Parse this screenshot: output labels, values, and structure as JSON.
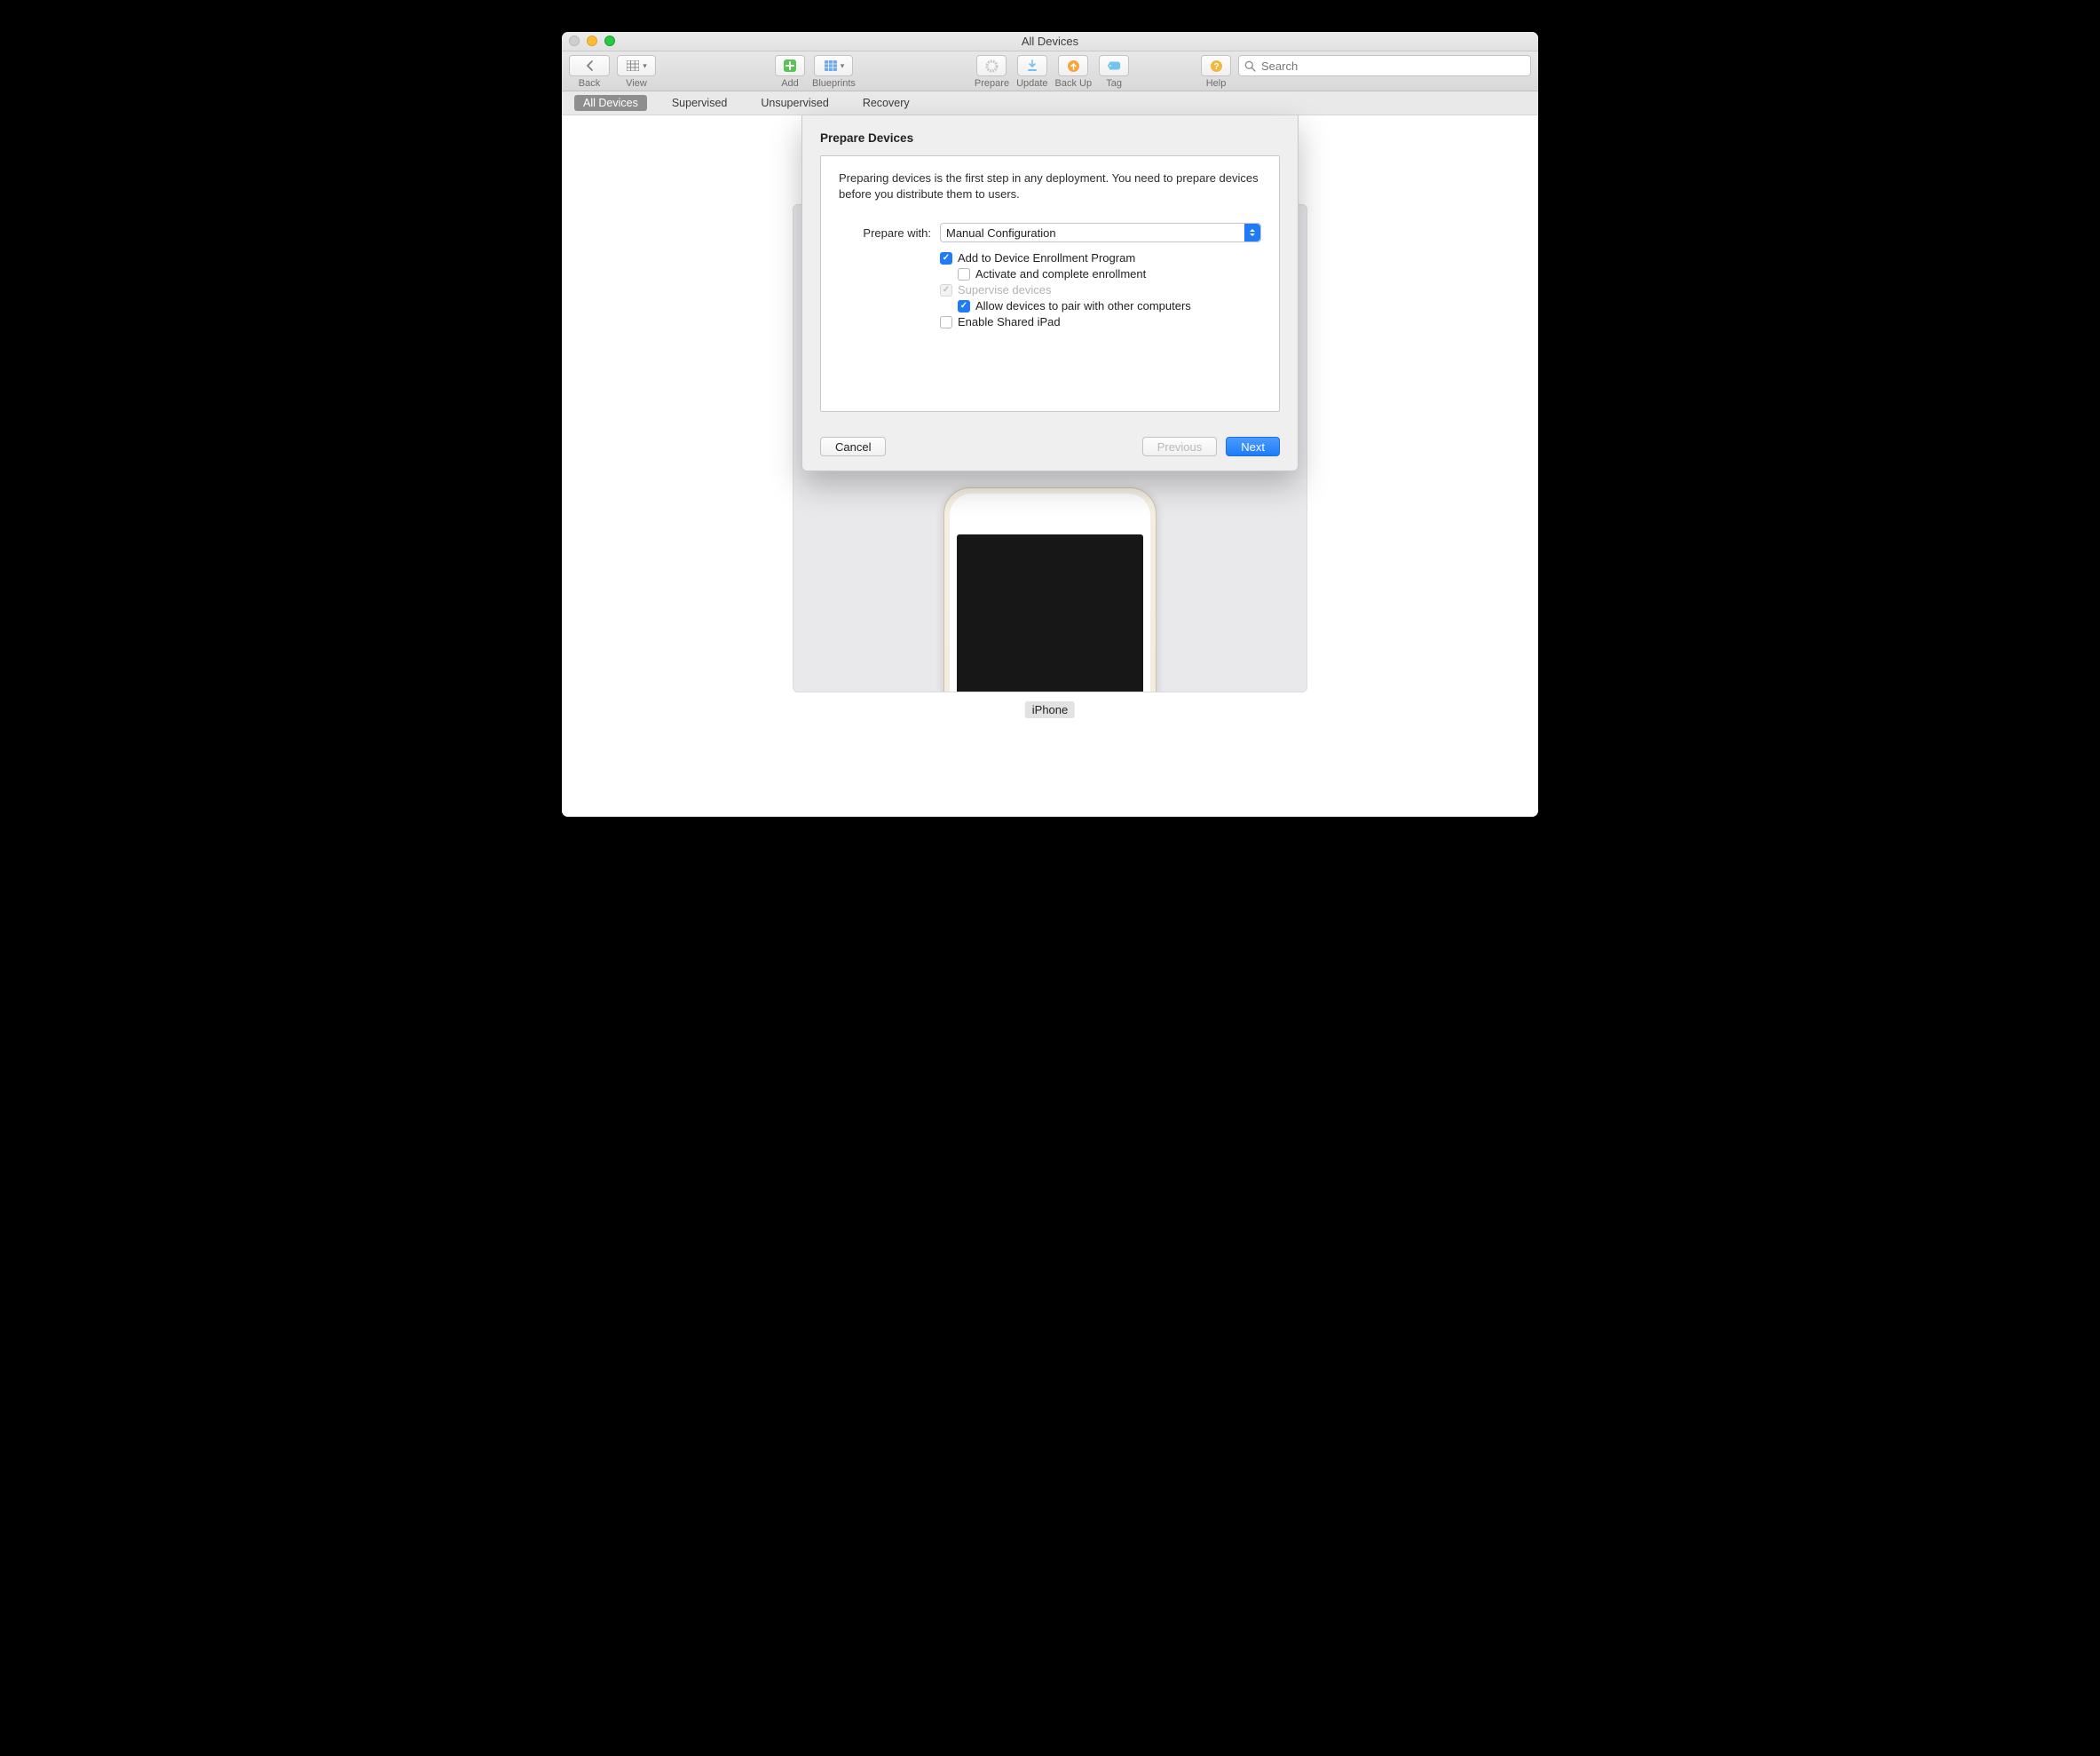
{
  "window": {
    "title": "All Devices"
  },
  "toolbar": {
    "back": "Back",
    "view": "View",
    "add": "Add",
    "blueprints": "Blueprints",
    "prepare": "Prepare",
    "update": "Update",
    "backup": "Back Up",
    "tag": "Tag",
    "help": "Help"
  },
  "search": {
    "placeholder": "Search"
  },
  "filters": {
    "all": "All Devices",
    "supervised": "Supervised",
    "unsupervised": "Unsupervised",
    "recovery": "Recovery"
  },
  "device": {
    "label": "iPhone"
  },
  "sheet": {
    "title": "Prepare Devices",
    "description": "Preparing devices is the first step in any deployment. You need to prepare devices before you distribute them to users.",
    "prepare_with_label": "Prepare with:",
    "prepare_with_value": "Manual Configuration",
    "opt_add_dep": "Add to Device Enrollment Program",
    "opt_activate": "Activate and complete enrollment",
    "opt_supervise": "Supervise devices",
    "opt_pair": "Allow devices to pair with other computers",
    "opt_shared_ipad": "Enable Shared iPad",
    "cancel": "Cancel",
    "previous": "Previous",
    "next": "Next"
  }
}
